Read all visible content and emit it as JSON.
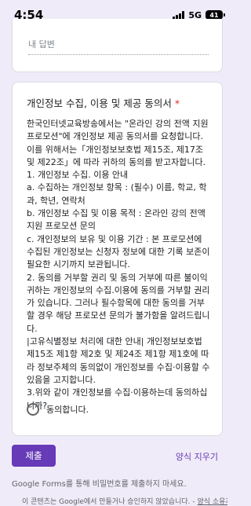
{
  "status_bar": {
    "time": "4:54",
    "network": "5G",
    "battery": "41"
  },
  "short_answer": {
    "placeholder": "내 답변"
  },
  "question": {
    "title": "개인정보 수집, 이용 및 제공 동의서",
    "required_mark": "*",
    "description_lines": [
      "한국인터넷교육방송에서는 \"온라인 강의 전액 지원 프로모션\"에 개인정보 제공 동의서를 요청합니다.",
      "이를 위해서는「개인정보보호법 제15조, 제17조 및 제22조」에 따라 귀하의 동의를 받고자합니다.",
      "1. 개인정보 수집. 이용 안내",
      "a. 수집하는 개인정보 항목 : (필수) 이름, 학교, 학과, 학년, 연락처",
      "b. 개인정보 수집 및 이용 목적 : 온라인 강의 전액 지원 프로모션 문의",
      "c. 개인정보의 보유 및 이용 기간 : 본 프로모션에 수집된 개인정보는 신청자 정보에 대한 기록 보존이 필요한 시기까지 보관됩니다.",
      "2. 동의를 거부할 권리 및 동의 거부에 따른 불이익",
      "귀하는 개인정보의 수집.이용에 동의를 거부할 권리가 있습니다. 그러나 필수항목에 대한 동의를 거부할 경우 해당 프로모션 문의가 불가함을 알려드립니다.",
      "|고유식별정보 처리에 대한 안내| 개인정보보호법 제15조 제1항 제2호 및 제24조 제1항 제1호에 따라 정보주체의 동의없이 개인정보를 수집·이용할 수 있음을 고지합니다.",
      "3.위와 같이 개인정보를 수집·이용하는데 동의하십니까?"
    ],
    "option_label": "동의합니다."
  },
  "actions": {
    "submit_label": "제출",
    "clear_label": "양식 지우기"
  },
  "footer": {
    "note": "Google Forms를 통해 비밀번호를 제출하지 마세요.",
    "disclaimer": "이 콘텐츠는 Google에서 만들거나 승인하지 않았습니다. - ",
    "disclaimer_link": "양식 소유자"
  }
}
